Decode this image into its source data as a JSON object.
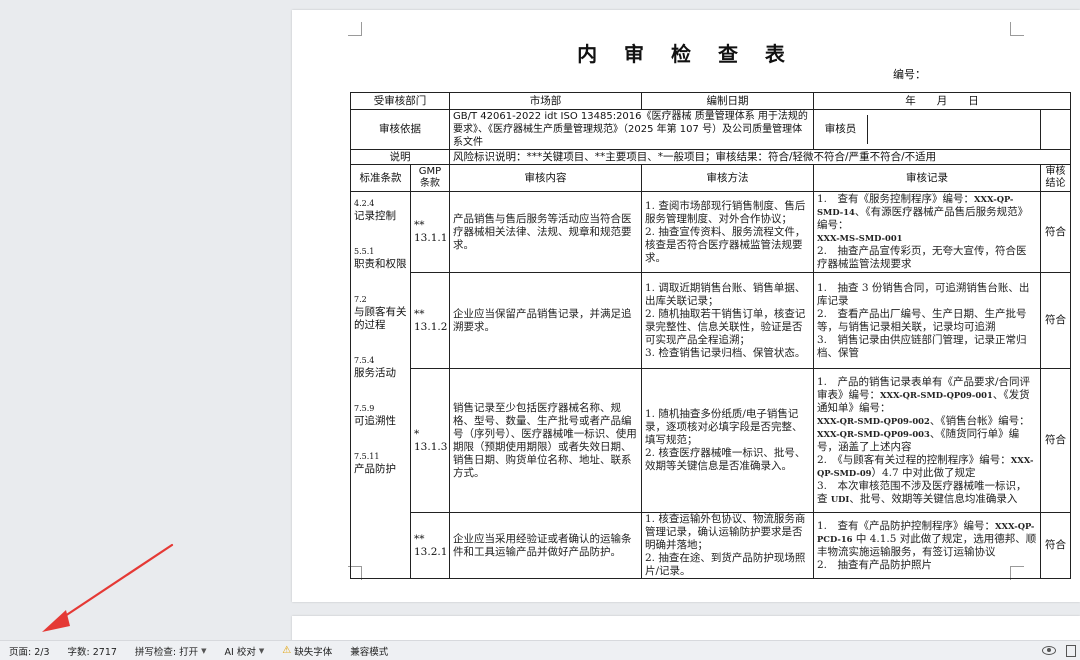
{
  "document": {
    "title": "内 审 检 查 表",
    "number_label": "编号：",
    "header": {
      "dept_label": "受审核部门",
      "dept_value": "市场部",
      "date_label": "编制日期",
      "date_value": "年　　月　　日",
      "basis_label": "审核依据",
      "basis_value": "GB/T 42061-2022 idt ISO 13485:2016《医疗器械 质量管理体系 用于法规的要求》、《医疗器械生产质量管理规范》（2025 年第 107 号）及公司质量管理体系文件",
      "auditor_label": "审核员",
      "auditor_value": "",
      "note_label": "说明",
      "note_value": "风险标识说明：***关键项目、**主要项目、*一般项目；审核结果：符合/轻微不符合/严重不符合/不适用"
    },
    "columns": {
      "standard": "标准条款",
      "gmp": "GMP 条款",
      "content": "审核内容",
      "method": "审核方法",
      "record": "审核记录",
      "conclusion": "审核结论"
    },
    "standards": [
      {
        "code": "4.2.4",
        "name": "记录控制"
      },
      {
        "code": "5.5.1",
        "name": "职责和权限"
      },
      {
        "code": "7.2",
        "name": "与顾客有关的过程"
      },
      {
        "code": "7.5.4",
        "name": "服务活动"
      },
      {
        "code": "7.5.9",
        "name": "可追溯性"
      },
      {
        "code": "7.5.11",
        "name": "产品防护"
      }
    ],
    "rows": [
      {
        "risk": "**",
        "gmp": "13.1.1",
        "content": "产品销售与售后服务等活动应当符合医疗器械相关法律、法规、规章和规范要求。",
        "methods": [
          "1. 查阅市场部现行销售制度、售后服务管理制度、对外合作协议；",
          "2. 抽查宣传资料、服务流程文件，核查是否符合医疗器械监管法规要求。"
        ],
        "records": [
          {
            "pre": "1.　查有《服务控制程序》编号：",
            "code": "XXX-QP-SMD-14",
            "post": "、《有源医疗器械产品售后服务规范》编号："
          },
          {
            "pre": "",
            "code": "XXX-MS-SMD-001",
            "post": ""
          },
          {
            "pre": "2.　抽查产品宣传彩页，无夸大宣传，符合医疗器械监管法规要求",
            "code": "",
            "post": ""
          }
        ],
        "result": "符合"
      },
      {
        "risk": "**",
        "gmp": "13.1.2",
        "content": "企业应当保留产品销售记录，并满足追溯要求。",
        "methods": [
          "1. 调取近期销售台账、销售单据、出库关联记录；",
          "2. 随机抽取若干销售订单，核查记录完整性、信息关联性，验证是否可实现产品全程追溯；",
          "3. 检查销售记录归档、保管状态。"
        ],
        "records": [
          {
            "pre": "1.　抽查 3 份销售合同，可追溯销售台账、出库记录",
            "code": "",
            "post": ""
          },
          {
            "pre": "2.　查看产品出厂编号、生产日期、生产批号等，与销售记录相关联，记录均可追溯",
            "code": "",
            "post": ""
          },
          {
            "pre": "3.　销售记录由供应链部门管理，记录正常归档、保管",
            "code": "",
            "post": ""
          }
        ],
        "result": "符合"
      },
      {
        "risk": "*",
        "gmp": "13.1.3",
        "content": "销售记录至少包括医疗器械名称、规格、型号、数量、生产批号或者产品编号（序列号）、医疗器械唯一标识、使用期限（预期使用期限）或者失效日期、销售日期、购货单位名称、地址、联系方式。",
        "methods": [
          "1. 随机抽查多份纸质/电子销售记录，逐项核对必填字段是否完整、填写规范；",
          "2. 核查医疗器械唯一标识、批号、效期等关键信息是否准确录入。"
        ],
        "records": [
          {
            "pre": "1.　产品的销售记录表单有《产品要求/合同评审表》编号：",
            "code": "XXX-QR-SMD-QP09-001",
            "post": "、《发货通知单》编号："
          },
          {
            "pre": "",
            "code": "XXX-QR-SMD-QP09-002",
            "post": "、《销售台帐》编号："
          },
          {
            "pre": "",
            "code": "XXX-QR-SMD-QP09-003",
            "post": "、《随货同行单》编号，涵盖了上述内容"
          },
          {
            "pre": "2.　《与顾客有关过程的控制程序》编号：",
            "code": "XXX-QP-SMD-09",
            "post": "）4.7 中对此做了规定"
          },
          {
            "pre": "3.　本次审核范围不涉及医疗器械唯一标识，查 ",
            "code": "UDI",
            "post": "、批号、效期等关键信息均准确录入"
          }
        ],
        "result": "符合"
      },
      {
        "risk": "**",
        "gmp": "13.2.1",
        "content": "企业应当采用经验证或者确认的运输条件和工具运输产品并做好产品防护。",
        "methods": [
          "1. 核查运输外包协议、物流服务商管理记录，确认运输防护要求是否明确并落地；",
          "2. 抽查在途、到货产品防护现场照片/记录。"
        ],
        "records": [
          {
            "pre": "1.　查有《产品防护控制程序》编号：",
            "code": "XXX-QP-PCD-16",
            "post": " 中 4.1.5 对此做了规定，选用德邦、顺丰物流实施运输服务，有签订运输协议"
          },
          {
            "pre": "2.　抽查有产品防护照片",
            "code": "",
            "post": ""
          }
        ],
        "result": "符合"
      }
    ]
  },
  "statusbar": {
    "page": "页面: 2/3",
    "words": "字数: 2717",
    "spell": "拼写检查: 打开",
    "ai": "AI 校对",
    "font_warning": "缺失字体",
    "compat": "兼容模式"
  },
  "colors": {
    "workspace_bg": "#e9ebee",
    "annotation_arrow": "#e53935"
  }
}
